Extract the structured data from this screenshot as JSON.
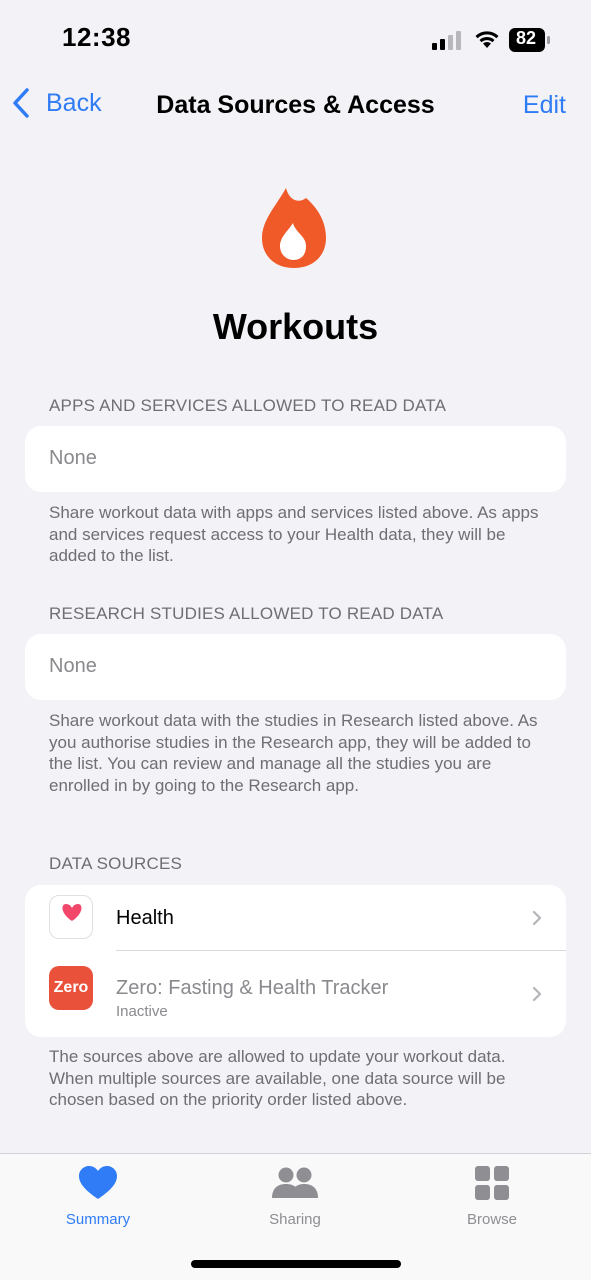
{
  "status_bar": {
    "time": "12:38",
    "battery": "82"
  },
  "nav": {
    "back_label": "Back",
    "title": "Data Sources & Access",
    "edit_label": "Edit"
  },
  "hero": {
    "icon": "flame-icon",
    "title": "Workouts",
    "accent": "#f05a28"
  },
  "apps_section": {
    "header": "APPS AND SERVICES ALLOWED TO READ DATA",
    "value": "None",
    "footer": "Share workout data with apps and services listed above. As apps and services request access to your Health data, they will be added to the list."
  },
  "research_section": {
    "header": "RESEARCH STUDIES ALLOWED TO READ DATA",
    "value": "None",
    "footer": "Share workout data with the studies in Research listed above. As you authorise studies in the Research app, they will be added to the list. You can review and manage all the studies you are enrolled in by going to the Research app."
  },
  "sources_section": {
    "header": "DATA SOURCES",
    "items": [
      {
        "name": "Health",
        "icon": "health-heart-icon"
      },
      {
        "name": "Zero: Fasting & Health Tracker",
        "subtitle": "Inactive",
        "icon": "zero-app-icon",
        "icon_text": "Zero"
      }
    ],
    "footer": "The sources above are allowed to update your workout data. When multiple sources are available, one data source will be chosen based on the priority order listed above."
  },
  "tab_bar": {
    "tabs": [
      {
        "label": "Summary",
        "icon": "heart-icon",
        "active": true
      },
      {
        "label": "Sharing",
        "icon": "people-icon",
        "active": false
      },
      {
        "label": "Browse",
        "icon": "grid-icon",
        "active": false
      }
    ],
    "accent": "#2f7cf6"
  }
}
